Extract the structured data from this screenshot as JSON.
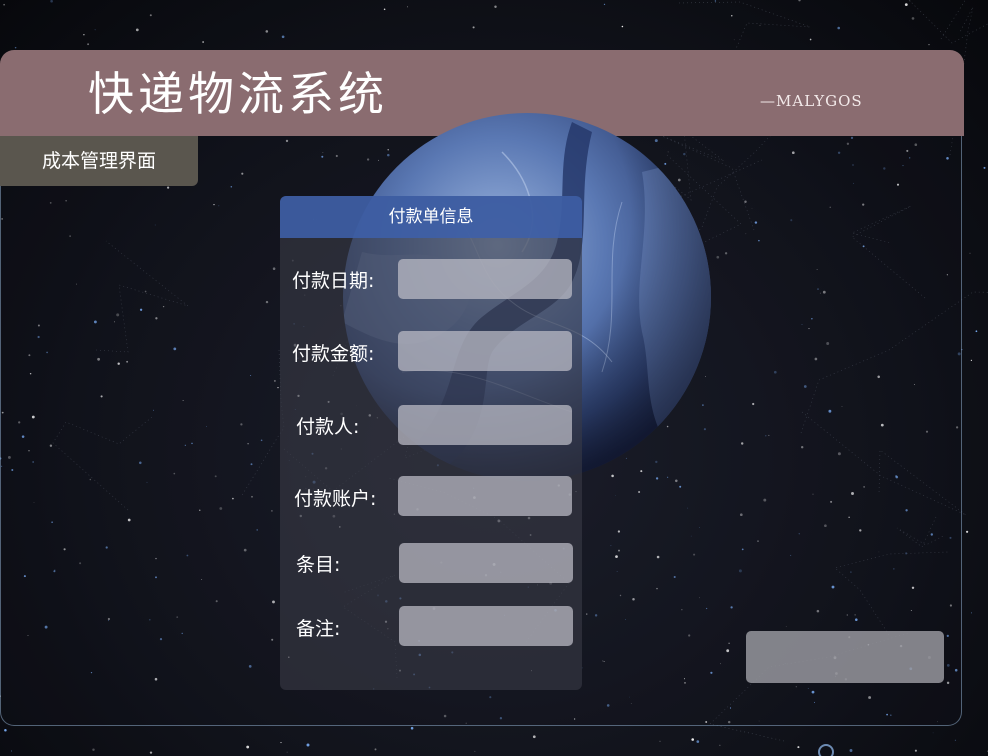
{
  "header": {
    "title": "快递物流系统",
    "subtitle": "—MALYGOS",
    "bar_color": "#8a6c70"
  },
  "page_tab": {
    "label": "成本管理界面"
  },
  "form": {
    "title": "付款单信息",
    "header_color": "#3e60aa",
    "fields": [
      {
        "label": "付款日期:",
        "value": ""
      },
      {
        "label": "付款金额:",
        "value": ""
      },
      {
        "label": "付款人:",
        "value": ""
      },
      {
        "label": "付款账户:",
        "value": ""
      },
      {
        "label": "条目:",
        "value": ""
      },
      {
        "label": "备注:",
        "value": ""
      }
    ]
  },
  "actions": {
    "submit_label": ""
  },
  "icons": {
    "globe": "earth-globe-image",
    "corner": "circle-icon"
  }
}
